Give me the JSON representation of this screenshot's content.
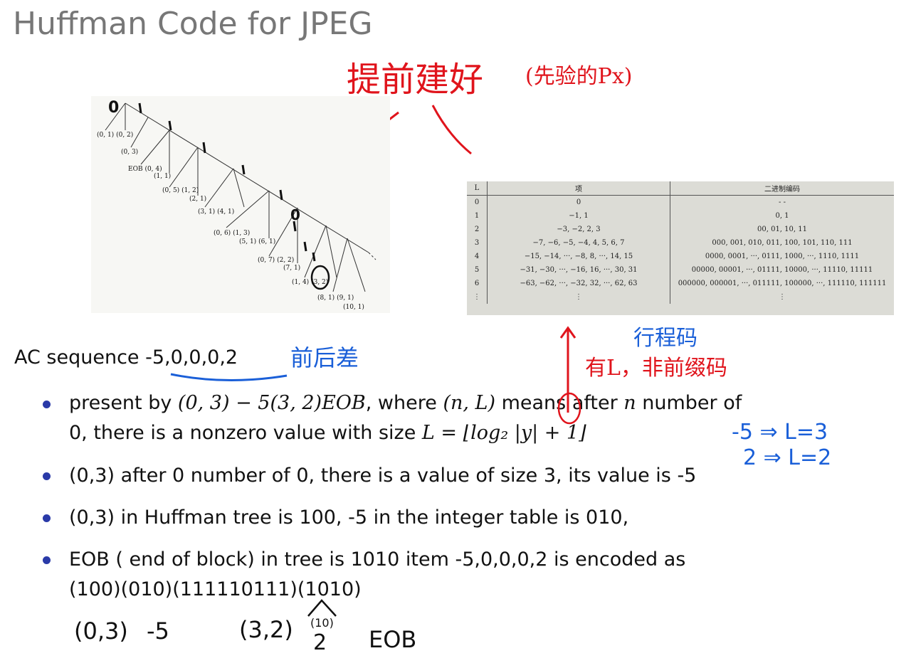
{
  "slide": {
    "title": "Huffman Code for JPEG"
  },
  "annotations": {
    "top_red": "提前建好",
    "top_red_paren": "(先验的Px)",
    "run_code_blue": "行程码",
    "has_l_red": "有L，非前缀码",
    "diff_blue": "前后差",
    "minus5_rule": "-5 ⇒ L=3",
    "two_rule": "2 ⇒ L=2",
    "bottom_labels": [
      "(0,3)",
      "-5",
      "(3,2)",
      "(10)",
      "2",
      "EOB"
    ],
    "tree_marks": [
      "0",
      "1"
    ]
  },
  "tree": {
    "labels": [
      "(0, 1)",
      "(0, 2)",
      "(0, 3)",
      "EOB",
      "(0, 4)",
      "(1, 1)",
      "(0, 5)",
      "(1, 2)",
      "(2, 1)",
      "(3, 1)",
      "(4, 1)",
      "(0, 6)",
      "(1, 3)",
      "(5, 1)",
      "(6, 1)",
      "(0, 7)",
      "(2, 2)",
      "(7, 1)",
      "(1, 4)",
      "(3, 2)",
      "(8, 1)",
      "(9, 1)",
      "(10, 1)"
    ]
  },
  "int_table": {
    "headers": [
      "L",
      "项",
      "二进制编码"
    ],
    "rows": [
      [
        "0",
        "0",
        "- -"
      ],
      [
        "1",
        "−1, 1",
        "0, 1"
      ],
      [
        "2",
        "−3, −2, 2, 3",
        "00, 01, 10, 11"
      ],
      [
        "3",
        "−7, −6, −5, −4, 4, 5, 6, 7",
        "000, 001, 010, 011, 100, 101, 110, 111"
      ],
      [
        "4",
        "−15, −14, ···, −8, 8, ···, 14, 15",
        "0000, 0001, ···, 0111, 1000, ···, 1110, 1111"
      ],
      [
        "5",
        "−31, −30, ···, −16, 16, ···, 30, 31",
        "00000, 00001, ···, 01111, 10000, ···, 11110, 11111"
      ],
      [
        "6",
        "−63, −62, ···, −32, 32, ···, 62, 63",
        "000000, 000001, ···, 011111, 100000, ···, 111110, 111111"
      ],
      [
        "⋮",
        "⋮",
        "⋮"
      ]
    ]
  },
  "body": {
    "ac_prefix": "AC sequence ",
    "ac_values": "-5,0,0,0,2",
    "b1_a": "present by ",
    "b1_math1": "(0, 3) − 5(3, 2)EOB",
    "b1_b": ", where ",
    "b1_math2": "(n, L)",
    "b1_c": " means after ",
    "b1_n": "n",
    "b1_d": " number of",
    "b1_line2a": "0, there is a nonzero value with size ",
    "b1_math3": "L = ⌊log₂ |y| + 1⌋",
    "b2": "(0,3) after 0 number of 0, there is a value of size 3, its value is -5",
    "b3": "(0,3) in Huffman tree is 100, -5 in the integer table is 010,",
    "b4_line1": "EOB ( end of block) in tree is 1010 item -5,0,0,0,2 is encoded as",
    "b4_line2": "(100)(010)(111110111)(1010)"
  },
  "colors": {
    "red": "#e0141c",
    "blue": "#1a5fd8",
    "bullet": "#2a3aa8",
    "title": "#777777"
  }
}
